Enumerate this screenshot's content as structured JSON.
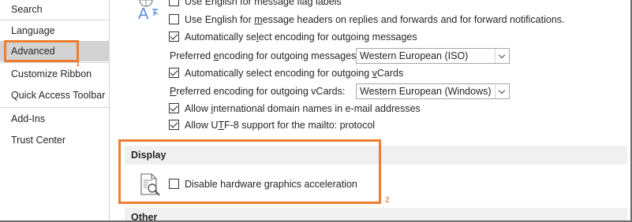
{
  "sidebar": {
    "items": [
      {
        "label": "Search"
      },
      {
        "label": "Language"
      },
      {
        "label": "Advanced"
      },
      {
        "label": "Customize Ribbon"
      },
      {
        "label": "Quick Access Toolbar"
      },
      {
        "label": "Add-Ins"
      },
      {
        "label": "Trust Center"
      }
    ],
    "selected": "Advanced",
    "callout_number": "1"
  },
  "main": {
    "options": [
      {
        "label_pre": "Use English for message flag labels",
        "checked": false
      },
      {
        "label_pre": "Use English for ",
        "label_u": "m",
        "label_post": "essage headers on replies and forwards and for forward notifications.",
        "checked": false
      },
      {
        "label_pre": "Automatically se",
        "label_u": "l",
        "label_post": "ect encoding for outgoing messages",
        "checked": true
      },
      {
        "label_pre": "Automatically select encoding for outgoing ",
        "label_u": "v",
        "label_post": "Cards",
        "checked": true
      },
      {
        "label_pre": "Allow ",
        "label_u": "i",
        "label_post": "nternational domain names in e-mail addresses",
        "checked": true
      },
      {
        "label_pre": "Allow U",
        "label_u": "T",
        "label_post": "F-8 support for the mailto: protocol",
        "checked": true
      }
    ],
    "encoding_messages": {
      "label_pre": "Preferred ",
      "label_u": "e",
      "label_post": "ncoding for outgoing messages:",
      "value": "Western European (ISO)"
    },
    "encoding_vcards": {
      "label_pre": "",
      "label_u": "P",
      "label_post": "referred encoding for outgoing vCards:",
      "value": "Western European (Windows)"
    },
    "display": {
      "title": "Display",
      "option_pre": "Disable hardware ",
      "option_u": "g",
      "option_post": "raphics acceleration",
      "checked": false,
      "callout_number": "2"
    },
    "other": {
      "title": "Other"
    }
  },
  "icons": {
    "language_icon": "font-language-icon",
    "display_icon": "document-magnifier-icon"
  },
  "colors": {
    "accent_callout": "#ed7d31",
    "nav_selected": "#d2d2d2",
    "section_bg": "#f0f0f0"
  }
}
